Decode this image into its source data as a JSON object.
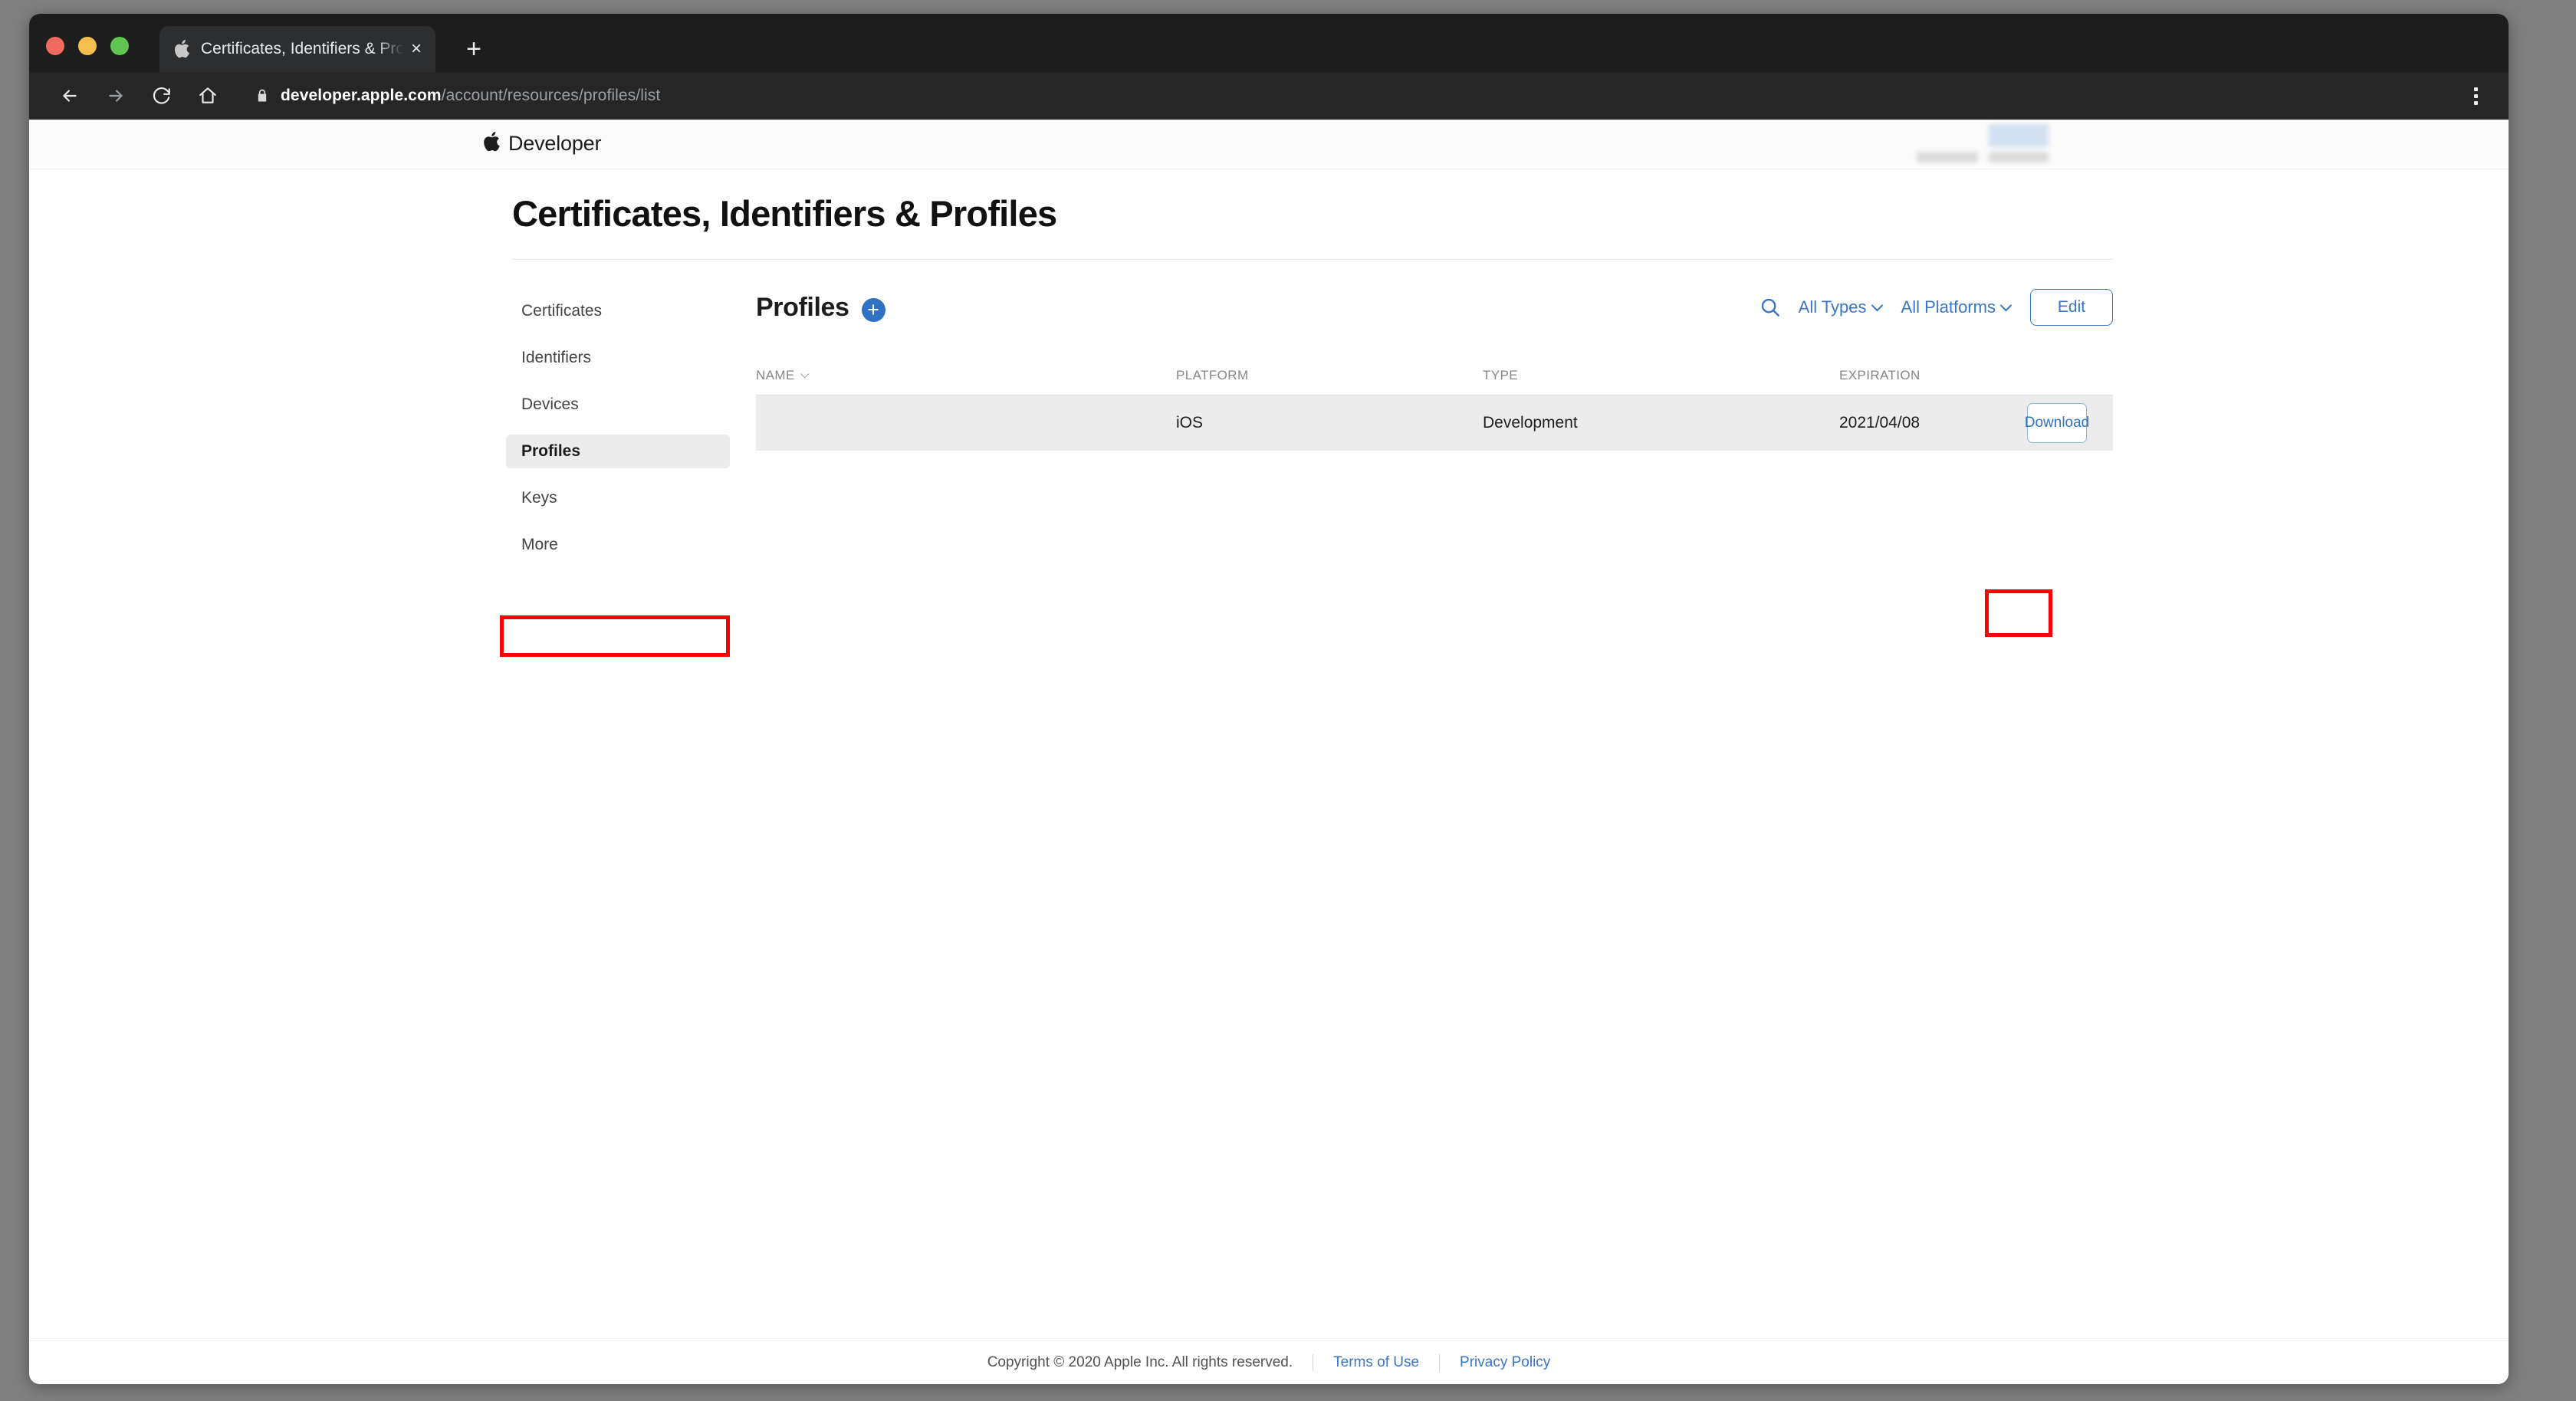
{
  "browser": {
    "tab": {
      "title": "Certificates, Identifiers & Profiles",
      "favicon": "apple-logo-icon",
      "close_label": "×"
    },
    "new_tab_label": "+",
    "nav": {
      "back": "back-arrow-icon",
      "forward": "forward-arrow-icon",
      "reload": "reload-icon",
      "home": "home-icon"
    },
    "address": {
      "lock": "lock-icon",
      "host": "developer.apple.com",
      "path": "/account/resources/profiles/list"
    },
    "menu_label": "kebab-menu-icon"
  },
  "site_header": {
    "brand": "Developer",
    "apple_logo": "apple-logo-icon"
  },
  "page": {
    "title": "Certificates, Identifiers & Profiles"
  },
  "sidebar": {
    "items": [
      {
        "label": "Certificates",
        "selected": false
      },
      {
        "label": "Identifiers",
        "selected": false
      },
      {
        "label": "Devices",
        "selected": false
      },
      {
        "label": "Profiles",
        "selected": true
      },
      {
        "label": "Keys",
        "selected": false
      },
      {
        "label": "More",
        "selected": false
      }
    ]
  },
  "panel": {
    "title": "Profiles",
    "add_label": "+",
    "search_icon": "search-icon",
    "filters": [
      {
        "label": "All Types"
      },
      {
        "label": "All Platforms"
      }
    ],
    "edit_label": "Edit"
  },
  "table": {
    "columns": [
      "NAME",
      "PLATFORM",
      "TYPE",
      "EXPIRATION"
    ],
    "rows": [
      {
        "name": "",
        "name_redacted": true,
        "platform": "iOS",
        "type": "Development",
        "expiration": "2021/04/08",
        "action": "Download"
      }
    ]
  },
  "footer": {
    "copyright": "Copyright © 2020 Apple Inc. All rights reserved.",
    "links": [
      "Terms of Use",
      "Privacy Policy"
    ]
  },
  "colors": {
    "accent_blue": "#3b76c4",
    "add_button_blue": "#2f72c4",
    "annotation_red": "#ff0000",
    "row_background": "#ececec",
    "desktop_backdrop": "#808080"
  }
}
